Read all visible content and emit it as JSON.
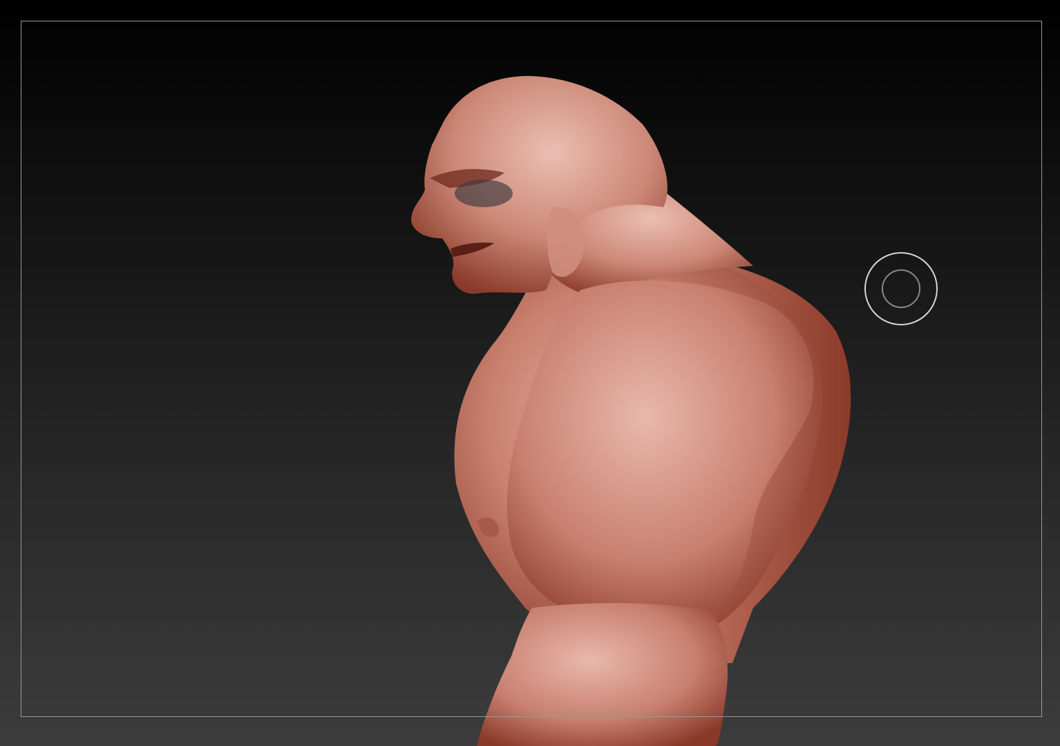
{
  "canvas": {
    "background_top": "#000000",
    "background_bottom": "#3c3c3c",
    "frame_color": "#9a9a9a"
  },
  "model": {
    "icon": "sculpt-mesh",
    "skin_light": "#e7b3a7",
    "skin_mid": "#c47a68",
    "skin_dark": "#7e3324"
  },
  "gizmo": {
    "icon": "rotation-gizmo-icon",
    "outer_color": "#d8d8d8",
    "inner_color": "#8a8a8a"
  }
}
